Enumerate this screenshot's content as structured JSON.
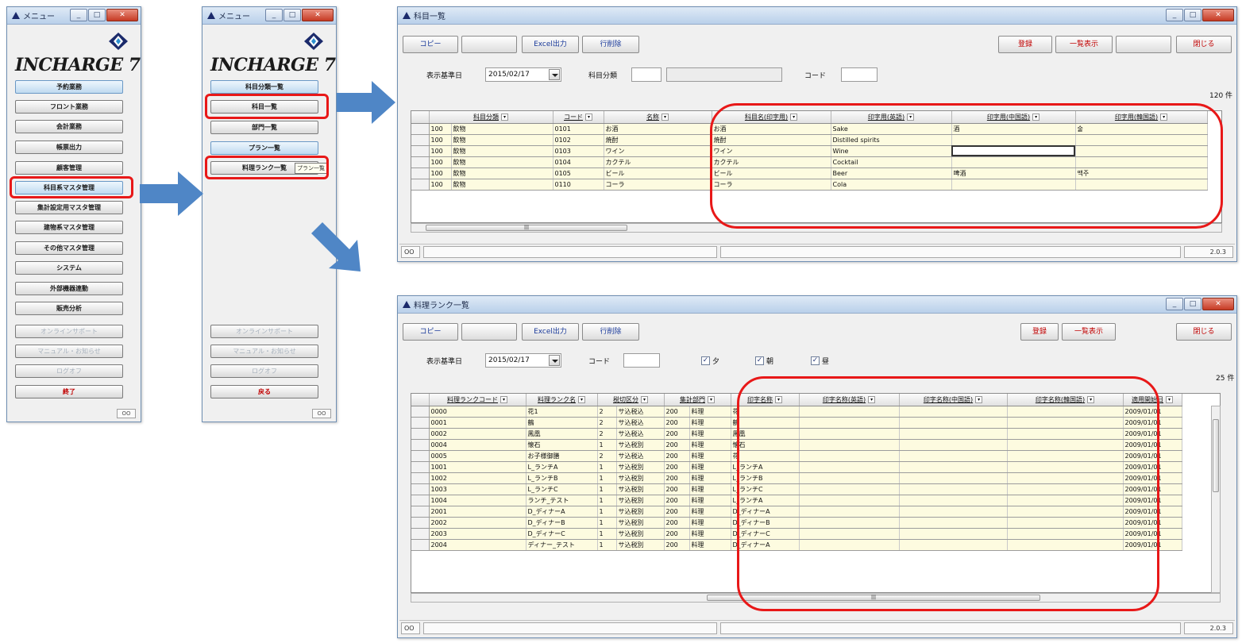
{
  "menu1": {
    "title": "メニュー",
    "logo": "INCHARGE 7",
    "buttons": [
      "予約業務",
      "フロント業務",
      "会計業務",
      "帳票出力",
      "顧客管理",
      "科目系マスタ管理",
      "集計設定用マスタ管理",
      "建物系マスタ管理",
      "その他マスタ管理",
      "システム",
      "外部機器連動",
      "販売分析"
    ],
    "sub_buttons": [
      "オンラインサポート",
      "マニュアル・お知らせ",
      "ログオフ"
    ],
    "end": "終了",
    "status": "OO"
  },
  "menu2": {
    "title": "メニュー",
    "logo": "INCHARGE 7",
    "buttons": [
      "科目分類一覧",
      "科目一覧",
      "部門一覧",
      "プラン一覧",
      "料理ランク一覧"
    ],
    "tooltip": "プラン一覧",
    "sub_buttons": [
      "オンラインサポート",
      "マニュアル・お知らせ",
      "ログオフ"
    ],
    "end": "戻る",
    "status": "OO"
  },
  "kamoku": {
    "title": "科目一覧",
    "toolbar": {
      "copy": "コピー",
      "excel": "Excel出力",
      "delete_row": "行削除",
      "register": "登録",
      "list_view": "一覧表示",
      "close": "閉じる"
    },
    "filter": {
      "date_label": "表示基準日",
      "date_value": "2015/02/17",
      "category_label": "科目分類",
      "code_label": "コード"
    },
    "count": "120 件",
    "columns": [
      "科目分類",
      "コード",
      "名称",
      "科目名(印字用)",
      "印字用(英語)",
      "印字用(中国語)",
      "印字用(韓国語)"
    ],
    "rows": [
      [
        "100",
        "飲物",
        "0101",
        "お酒",
        "お酒",
        "Sake",
        "酒",
        "술"
      ],
      [
        "100",
        "飲物",
        "0102",
        "焼酎",
        "焼酎",
        "Distilled spirits",
        "",
        ""
      ],
      [
        "100",
        "飲物",
        "0103",
        "ワイン",
        "ワイン",
        "Wine",
        "",
        ""
      ],
      [
        "100",
        "飲物",
        "0104",
        "カクテル",
        "カクテル",
        "Cocktail",
        "",
        ""
      ],
      [
        "100",
        "飲物",
        "0105",
        "ビール",
        "ビール",
        "Beer",
        "啤酒",
        "맥주"
      ],
      [
        "100",
        "飲物",
        "0110",
        "コーラ",
        "コーラ",
        "Cola",
        "",
        ""
      ]
    ],
    "status_right": "2.0.3",
    "status_left": "OO"
  },
  "ryouri": {
    "title": "料理ランク一覧",
    "toolbar": {
      "copy": "コピー",
      "excel": "Excel出力",
      "delete_row": "行削除",
      "register": "登録",
      "list_view": "一覧表示",
      "close": "閉じる"
    },
    "filter": {
      "date_label": "表示基準日",
      "date_value": "2015/02/17",
      "code_label": "コード",
      "chk1": "夕",
      "chk2": "朝",
      "chk3": "昼"
    },
    "count": "25 件",
    "columns": [
      "料理ランクコード",
      "料理ランク名",
      "税切区分",
      "集計部門",
      "印字名称",
      "印字名称(英語)",
      "印字名称(中国語)",
      "印字名称(韓国語)",
      "適用開始日"
    ],
    "rows": [
      [
        "0000",
        "花1",
        "2",
        "サ込税込",
        "200",
        "料理",
        "花",
        "",
        "",
        "",
        "2009/01/01"
      ],
      [
        "0001",
        "鶴",
        "2",
        "サ込税込",
        "200",
        "料理",
        "鶴",
        "",
        "",
        "",
        "2009/01/01"
      ],
      [
        "0002",
        "鳳凰",
        "2",
        "サ込税込",
        "200",
        "料理",
        "鳳凰",
        "",
        "",
        "",
        "2009/01/01"
      ],
      [
        "0004",
        "懐石",
        "1",
        "サ込税別",
        "200",
        "料理",
        "懐石",
        "",
        "",
        "",
        "2009/01/01"
      ],
      [
        "0005",
        "お子様御膳",
        "2",
        "サ込税込",
        "200",
        "料理",
        "花",
        "",
        "",
        "",
        "2009/01/01"
      ],
      [
        "1001",
        "L_ランチA",
        "1",
        "サ込税別",
        "200",
        "料理",
        "L_ランチA",
        "",
        "",
        "",
        "2009/01/01"
      ],
      [
        "1002",
        "L_ランチB",
        "1",
        "サ込税別",
        "200",
        "料理",
        "L_ランチB",
        "",
        "",
        "",
        "2009/01/01"
      ],
      [
        "1003",
        "L_ランチC",
        "1",
        "サ込税別",
        "200",
        "料理",
        "L_ランチC",
        "",
        "",
        "",
        "2009/01/01"
      ],
      [
        "1004",
        "ランチ_テスト",
        "1",
        "サ込税別",
        "200",
        "料理",
        "L_ランチA",
        "",
        "",
        "",
        "2009/01/01"
      ],
      [
        "2001",
        "D_ディナーA",
        "1",
        "サ込税別",
        "200",
        "料理",
        "D_ディナーA",
        "",
        "",
        "",
        "2009/01/01"
      ],
      [
        "2002",
        "D_ディナーB",
        "1",
        "サ込税別",
        "200",
        "料理",
        "D_ディナーB",
        "",
        "",
        "",
        "2009/01/01"
      ],
      [
        "2003",
        "D_ディナーC",
        "1",
        "サ込税別",
        "200",
        "料理",
        "D_ディナーC",
        "",
        "",
        "",
        "2009/01/01"
      ],
      [
        "2004",
        "ディナー_テスト",
        "1",
        "サ込税別",
        "200",
        "料理",
        "D_ディナーA",
        "",
        "",
        "",
        "2009/01/01"
      ]
    ],
    "status_right": "2.0.3",
    "status_left": "OO"
  },
  "colors": {
    "highlight": "#e81818",
    "arrow": "#4f86c6",
    "row_bg": "#fdfbe0"
  }
}
